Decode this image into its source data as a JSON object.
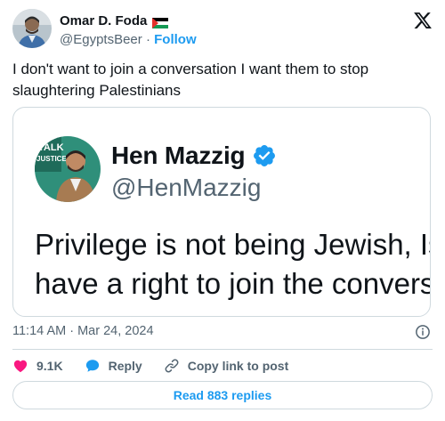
{
  "author": {
    "name": "Omar D. Foda",
    "handle": "@EgyptsBeer",
    "separator": "·",
    "follow_label": "Follow"
  },
  "tweet": {
    "text": "I don't want to join a conversation I want them to stop slaughtering Palestinians"
  },
  "quoted_image": {
    "avatar_banner_text": "TALK JUSTICE",
    "name": "Hen Mazzig",
    "handle": "@HenMazzig",
    "line1": "Privilege is not being Jewish, Isr",
    "line2": "have a right to join the conversa"
  },
  "meta": {
    "timestamp": "11:14 AM · Mar 24, 2024"
  },
  "actions": {
    "likes": "9.1K",
    "reply_label": "Reply",
    "copy_label": "Copy link to post"
  },
  "replies_button": {
    "label": "Read 883 replies"
  },
  "colors": {
    "accent": "#1d9bf0",
    "like": "#f91880",
    "muted": "#536471",
    "border": "#cfd9de"
  }
}
